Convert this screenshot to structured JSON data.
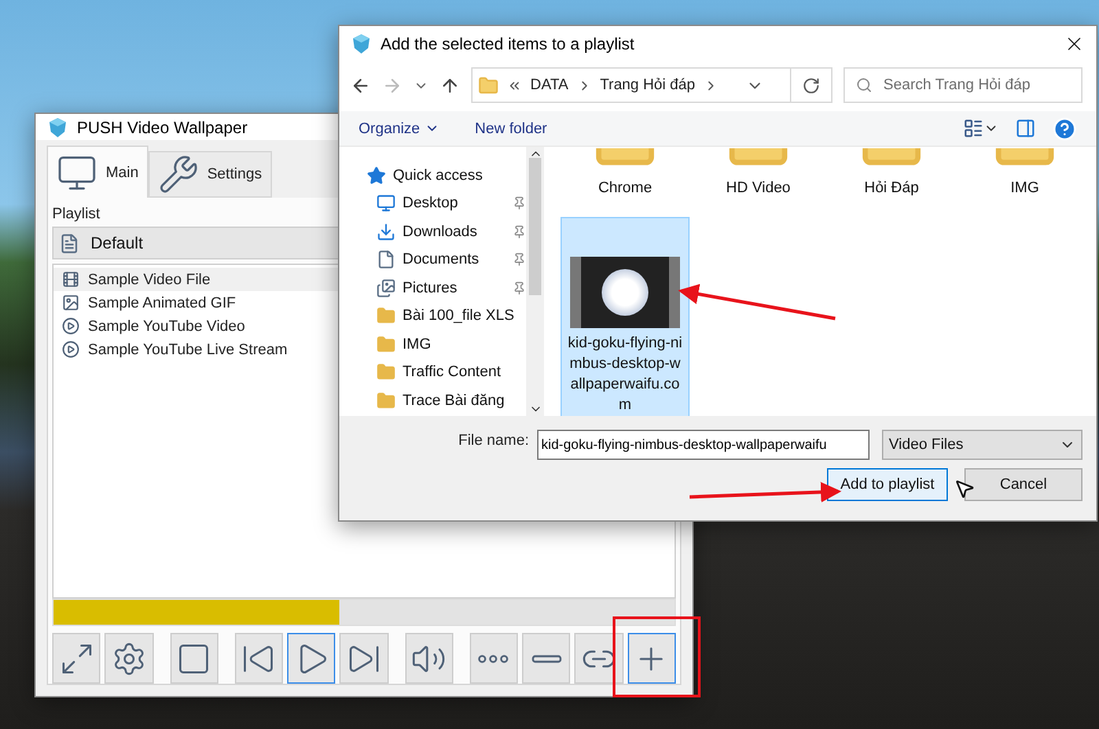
{
  "main_window": {
    "title": "PUSH Video Wallpaper",
    "tabs": [
      {
        "label": "Main",
        "kind": "monitor",
        "selected": true
      },
      {
        "label": "Settings",
        "kind": "tools",
        "selected": false
      }
    ],
    "playlist_label": "Playlist",
    "playlist_select": "Default",
    "items": [
      {
        "label": "Sample Video File",
        "kind": "video",
        "selected": true
      },
      {
        "label": "Sample Animated GIF",
        "kind": "image",
        "selected": false
      },
      {
        "label": "Sample YouTube Video",
        "kind": "youtube",
        "selected": false
      },
      {
        "label": "Sample YouTube Live Stream",
        "kind": "youtube",
        "selected": false
      }
    ],
    "progress": {
      "level": 0.46
    },
    "controls": [
      {
        "kind": "fullscreen",
        "focused": false
      },
      {
        "kind": "settings",
        "focused": false
      },
      {
        "kind": "stop",
        "focused": false
      },
      {
        "kind": "previous",
        "focused": false
      },
      {
        "kind": "play",
        "focused": true
      },
      {
        "kind": "next",
        "focused": false
      },
      {
        "kind": "volume",
        "focused": false
      },
      {
        "kind": "more",
        "focused": false
      },
      {
        "kind": "remove",
        "focused": false
      },
      {
        "kind": "link",
        "focused": false
      },
      {
        "kind": "add",
        "focused": true
      }
    ]
  },
  "dialog": {
    "title": "Add the selected items to a playlist",
    "path": [
      "DATA",
      "Trang Hỏi đáp"
    ],
    "search_placeholder": "Search Trang Hỏi đáp",
    "toolbar": {
      "organize": "Organize",
      "new_folder": "New folder"
    },
    "nav_pane": [
      {
        "label": "Quick access",
        "kind": "star",
        "pinned": false,
        "children": [
          {
            "label": "Desktop",
            "kind": "desktop",
            "pinned": true
          },
          {
            "label": "Downloads",
            "kind": "download",
            "pinned": true
          },
          {
            "label": "Documents",
            "kind": "documents",
            "pinned": true
          },
          {
            "label": "Pictures",
            "kind": "pictures",
            "pinned": true
          },
          {
            "label": "Bài 100_file XLS",
            "kind": "folder",
            "pinned": false
          },
          {
            "label": "IMG",
            "kind": "folder",
            "pinned": false
          },
          {
            "label": "Traffic Content",
            "kind": "folder",
            "pinned": false
          },
          {
            "label": "Trace Bài đăng",
            "kind": "folder",
            "pinned": false
          }
        ]
      }
    ],
    "files": [
      {
        "label": "Chrome",
        "kind": "folder",
        "selected": false
      },
      {
        "label": "HD Video",
        "kind": "folder",
        "selected": false
      },
      {
        "label": "Hỏi Đáp",
        "kind": "folder",
        "selected": false
      },
      {
        "label": "IMG",
        "kind": "folder",
        "selected": false
      },
      {
        "label": "kid-goku-flying-nimbus-desktop-wallpaperwaifu.com",
        "kind": "video",
        "selected": true
      }
    ],
    "file_name_label": "File name:",
    "file_name": "kid-goku-flying-nimbus-desktop-wallpaperwaifu",
    "file_type": "Video Files",
    "buttons": [
      {
        "label": "Add to playlist",
        "kind": "primary"
      },
      {
        "label": "Cancel",
        "kind": "secondary"
      }
    ]
  }
}
